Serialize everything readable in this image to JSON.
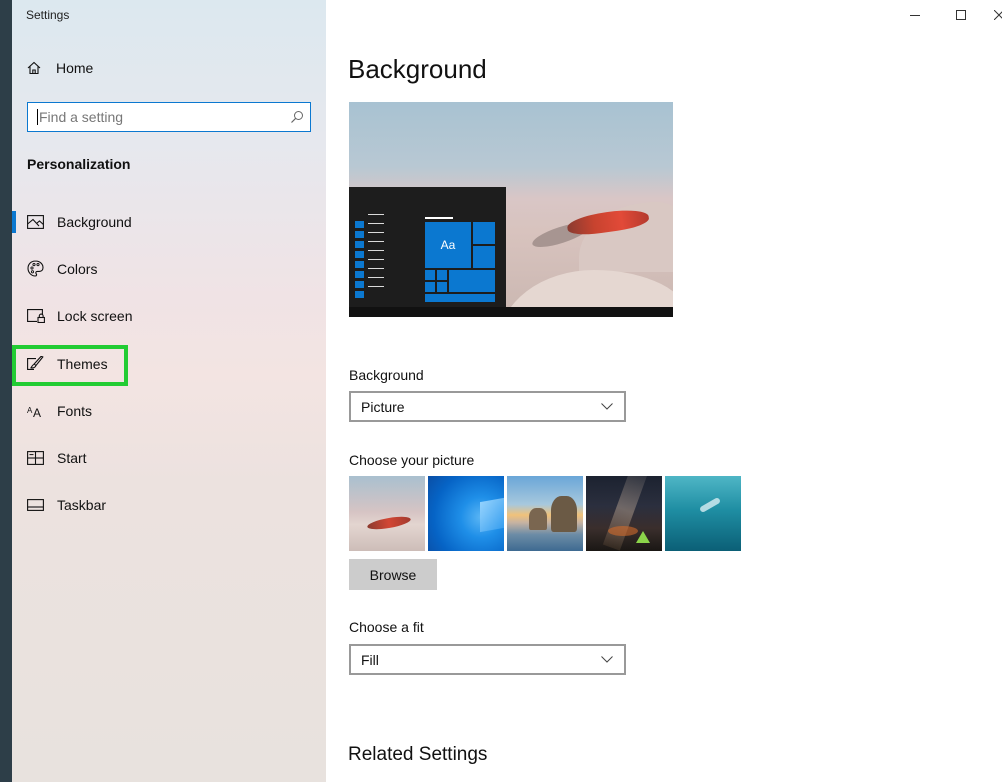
{
  "window": {
    "title": "Settings",
    "controls": [
      "minimize",
      "maximize",
      "close"
    ]
  },
  "sidebar": {
    "home_label": "Home",
    "search_placeholder": "Find a setting",
    "section_title": "Personalization",
    "items": [
      {
        "label": "Background",
        "icon": "image-icon",
        "selected": true
      },
      {
        "label": "Colors",
        "icon": "palette-icon",
        "selected": false
      },
      {
        "label": "Lock screen",
        "icon": "lock-screen-icon",
        "selected": false
      },
      {
        "label": "Themes",
        "icon": "themes-brush-icon",
        "selected": false,
        "highlighted": true
      },
      {
        "label": "Fonts",
        "icon": "fonts-icon",
        "selected": false
      },
      {
        "label": "Start",
        "icon": "start-layout-icon",
        "selected": false
      },
      {
        "label": "Taskbar",
        "icon": "taskbar-icon",
        "selected": false
      }
    ]
  },
  "main": {
    "title": "Background",
    "preview": {
      "tile_label": "Aa"
    },
    "background_label": "Background",
    "background_value": "Picture",
    "choose_picture_label": "Choose your picture",
    "browse_label": "Browse",
    "fit_label": "Choose a fit",
    "fit_value": "Fill",
    "related_title": "Related Settings"
  },
  "colors": {
    "accent": "#0b78d0",
    "highlight_box": "#22cc33",
    "sidebar_bg": "#e9e4e6",
    "button_bg": "#cccccc"
  }
}
